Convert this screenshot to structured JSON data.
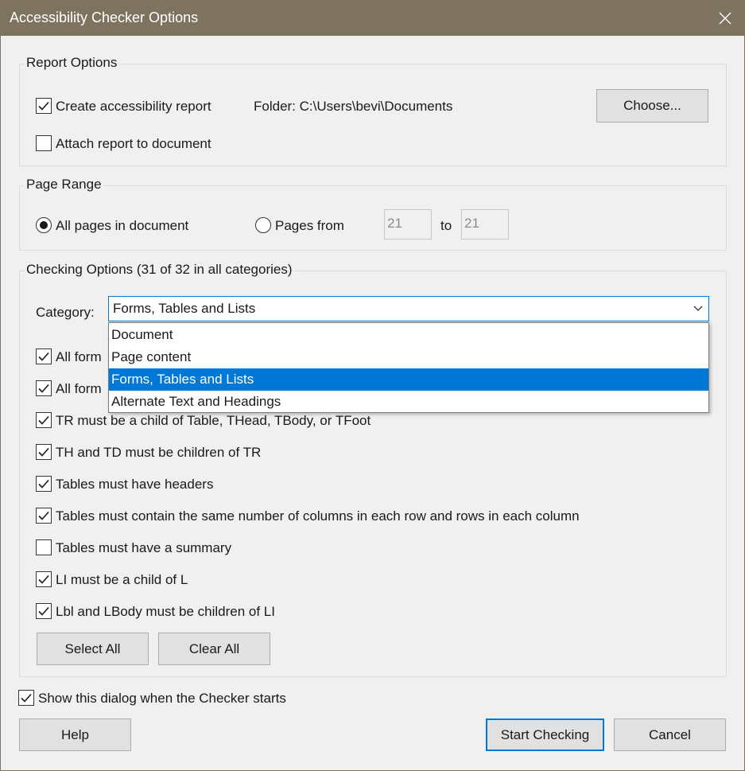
{
  "window": {
    "title": "Accessibility Checker Options"
  },
  "report_options": {
    "legend": "Report Options",
    "create_report": {
      "label": "Create accessibility report",
      "checked": true
    },
    "folder_text": "Folder: C:\\Users\\bevi\\Documents",
    "choose_label": "Choose...",
    "attach_report": {
      "label": "Attach report to document",
      "checked": false
    }
  },
  "page_range": {
    "legend": "Page Range",
    "all_pages_label": "All pages in document",
    "pages_from_label": "Pages from",
    "from_value": "21",
    "to_label": "to",
    "to_value": "21",
    "selected": "all"
  },
  "checking_options": {
    "legend": "Checking Options (31 of 32 in all categories)",
    "category_label": "Category:",
    "category_value": "Forms, Tables and Lists",
    "dropdown_options": [
      "Document",
      "Page content",
      "Forms, Tables and Lists",
      "Alternate Text and Headings"
    ],
    "selected_option": "Forms, Tables and Lists",
    "items": [
      {
        "label": "All form",
        "checked": true
      },
      {
        "label": "All form",
        "checked": true
      },
      {
        "label": "TR must be a child of Table, THead, TBody, or TFoot",
        "checked": true
      },
      {
        "label": "TH and TD must be children of TR",
        "checked": true
      },
      {
        "label": "Tables must have headers",
        "checked": true
      },
      {
        "label": "Tables must contain the same number of columns in each row and rows in each column",
        "checked": true
      },
      {
        "label": "Tables must have a summary",
        "checked": false
      },
      {
        "label": "LI must be a child of L",
        "checked": true
      },
      {
        "label": "Lbl and LBody must be children of LI",
        "checked": true
      }
    ],
    "select_all_label": "Select All",
    "clear_all_label": "Clear All"
  },
  "show_dialog": {
    "label": "Show this dialog when the Checker starts",
    "checked": true
  },
  "footer": {
    "help_label": "Help",
    "start_label": "Start Checking",
    "cancel_label": "Cancel"
  }
}
